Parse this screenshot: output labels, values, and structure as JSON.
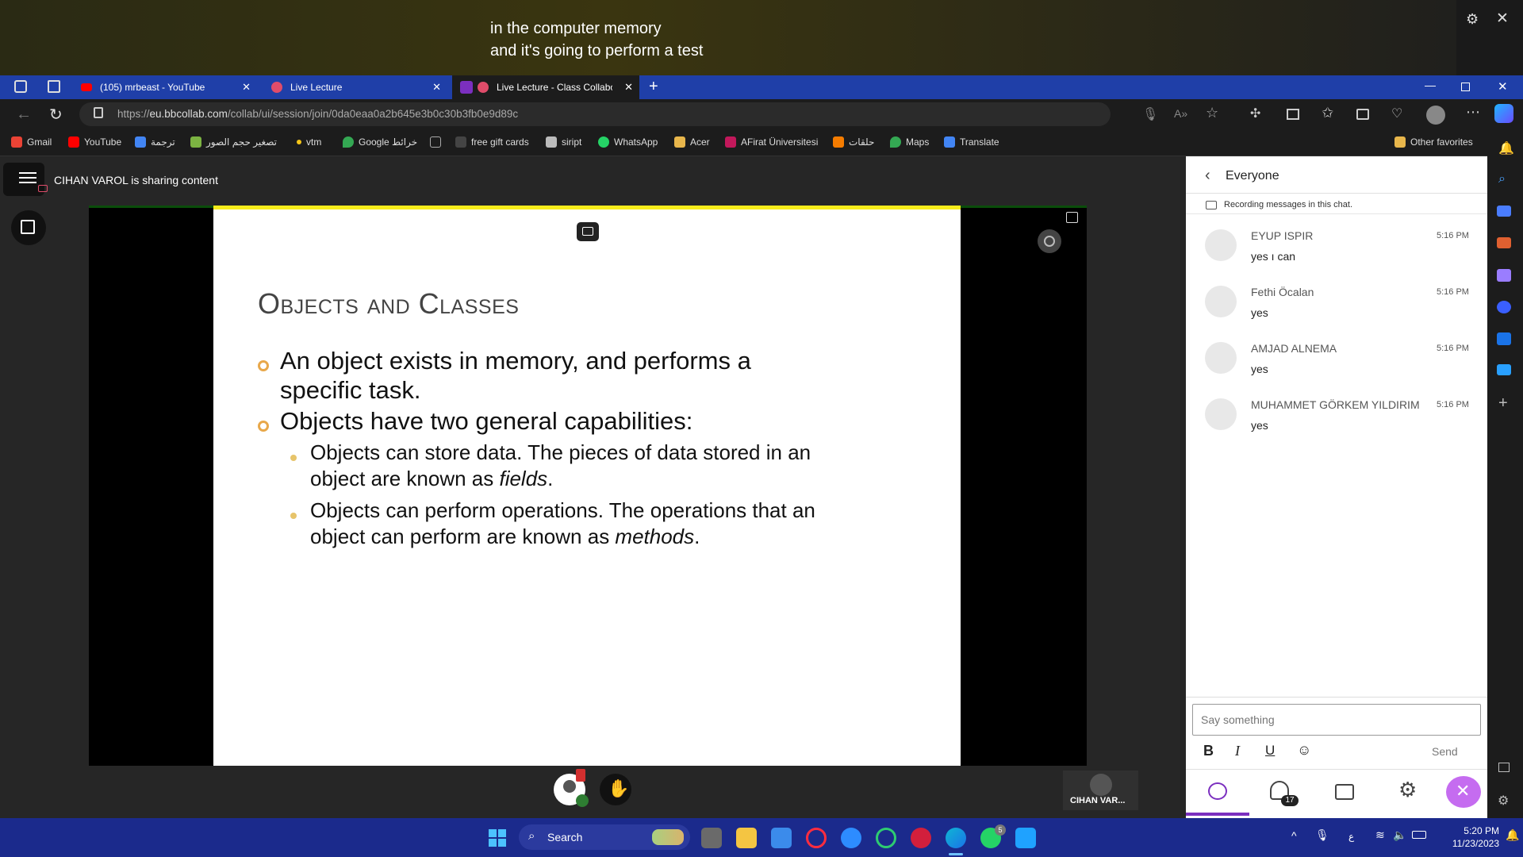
{
  "caption": {
    "line1": "in the computer memory",
    "line2": "and it's going to perform a test"
  },
  "tabs": [
    {
      "label": "(105) mrbeast - YouTube"
    },
    {
      "label": "Live Lecture"
    },
    {
      "label": "Live Lecture - Class Collabor"
    }
  ],
  "address": {
    "prefix": "https://",
    "domain": "eu.bbcollab.com",
    "path": "/collab/ui/session/join/0da0eaa0a2b645e3b0c30b3fb0e9d89c"
  },
  "favorites": [
    {
      "label": "Gmail",
      "color": "#ea4335"
    },
    {
      "label": "YouTube",
      "color": "#ff0000"
    },
    {
      "label": "ترجمة",
      "color": "#4285f4"
    },
    {
      "label": "تصغير حجم الصور",
      "color": "#7cb342"
    },
    {
      "label": "vtm",
      "color": "#f5c518"
    },
    {
      "label": "Google خرائط",
      "color": "#34a853"
    },
    {
      "label": "",
      "color": "#888888"
    },
    {
      "label": "free gift cards",
      "color": "#444444"
    },
    {
      "label": "siript",
      "color": "#bbbbbb"
    },
    {
      "label": "WhatsApp",
      "color": "#25d366"
    },
    {
      "label": "Acer",
      "color": "#e8b64b"
    },
    {
      "label": "AFirat Üniversitesi",
      "color": "#c2185b"
    },
    {
      "label": "حلقات",
      "color": "#f57c00"
    },
    {
      "label": "Maps",
      "color": "#34a853"
    },
    {
      "label": "Translate",
      "color": "#4285f4"
    }
  ],
  "other_favorites": "Other favorites",
  "session": {
    "sharing_label": "CIHAN VAROL is sharing content",
    "presenter_tile": "CIHAN VAR..."
  },
  "slide": {
    "title": "Objects and Classes",
    "bullet1": "An object exists in memory, and performs a specific task.",
    "bullet2": "Objects have two general capabilities:",
    "sub1_a": "Objects can store data. The pieces of data stored in an object are known as ",
    "sub1_em": "fields",
    "sub2_a": "Objects can perform operations. The operations that an object can perform are known as ",
    "sub2_em": "methods",
    "period": "."
  },
  "chat": {
    "header": "Everyone",
    "recording_notice": "Recording messages in this chat.",
    "messages": [
      {
        "name": "EYUP ISPIR",
        "time": "5:16 PM",
        "text": "yes ı can"
      },
      {
        "name": "Fethi Öcalan",
        "time": "5:16 PM",
        "text": "yes"
      },
      {
        "name": "AMJAD ALNEMA",
        "time": "5:16 PM",
        "text": "yes"
      },
      {
        "name": "MUHAMMET GÖRKEM YILDIRIM",
        "time": "5:16 PM",
        "text": "yes"
      }
    ],
    "input_placeholder": "Say something",
    "send_label": "Send",
    "participants_count": "17"
  },
  "taskbar": {
    "search_label": "Search",
    "time": "5:20 PM",
    "date": "11/23/2023",
    "whatsapp_badge": "5",
    "lang": "ع"
  },
  "colors": {
    "accent": "#7b2fbf",
    "tabbar": "#1f3fa8",
    "taskbar": "#1b2a8c",
    "slide_border": "#f7ec1b"
  }
}
